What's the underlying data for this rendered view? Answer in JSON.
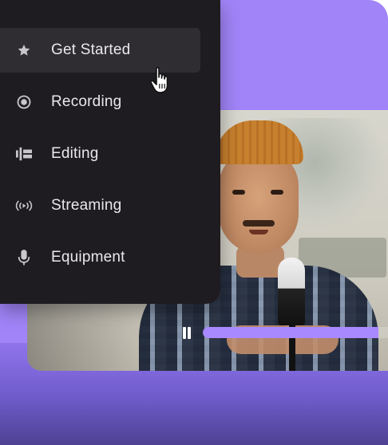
{
  "menu": {
    "items": [
      {
        "label": "Get Started",
        "icon": "star-icon",
        "active": true
      },
      {
        "label": "Recording",
        "icon": "record-icon",
        "active": false
      },
      {
        "label": "Editing",
        "icon": "timeline-edit-icon",
        "active": false
      },
      {
        "label": "Streaming",
        "icon": "broadcast-icon",
        "active": false
      },
      {
        "label": "Equipment",
        "icon": "microphone-icon",
        "active": false
      }
    ]
  },
  "player": {
    "state": "playing",
    "control_icon": "pause-icon",
    "progress_fraction": 0.95
  },
  "colors": {
    "accent": "#a184f8",
    "progress": "#a889ff",
    "menu_bg": "#1e1c20",
    "menu_active_bg": "#2f2d32"
  }
}
